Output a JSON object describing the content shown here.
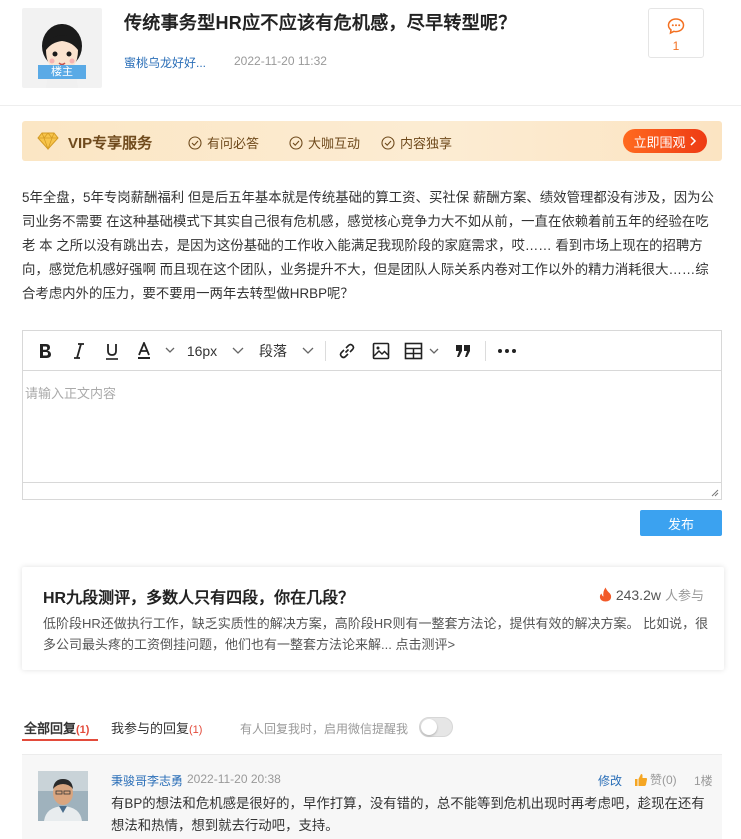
{
  "post": {
    "owner_tag": "楼主",
    "title": "传统事务型HR应不应该有危机感，尽早转型呢？",
    "author": "蜜桃乌龙好好...",
    "time": "2022-11-20 11:32",
    "comment_count": "1",
    "body": "5年全盘，5年专岗薪酬福利 但是后五年基本就是传统基础的算工资、买社保 薪酬方案、绩效管理都没有涉及，因为公司业务不需要 在这种基础模式下其实自己很有危机感，感觉核心竞争力大不如从前，一直在依赖着前五年的经验在吃老 本 之所以没有跳出去，是因为这份基础的工作收入能满足我现阶段的家庭需求，哎…… 看到市场上现在的招聘方向，感觉危机感好强啊 而且现在这个团队，业务提升不大，但是团队人际关系内卷对工作以外的精力消耗很大……综合考虑内外的压力，要不要用一两年去转型做HRBP呢？"
  },
  "vip": {
    "title": "VIP专享服务",
    "features": [
      "有问必答",
      "大咖互动",
      "内容独享"
    ],
    "button": "立即围观",
    "colors": {
      "accent": "#ee3b14",
      "text": "#6f4a1c",
      "background": "#fbe6c4"
    }
  },
  "editor": {
    "font_size": "16px",
    "paragraph": "段落",
    "placeholder": "请输入正文内容",
    "publish_label": "发布"
  },
  "promo": {
    "title": "HR九段测评，多数人只有四段，你在几段？",
    "count": "243.2w",
    "count_suffix": "人参与",
    "desc": "低阶段HR还做执行工作，缺乏实质性的解决方案，高阶段HR则有一整套方法论，提供有效的解决方案。 比如说，很多公司最头疼的工资倒挂问题，他们也有一整套方法论来解... 点击测评>"
  },
  "tabs": {
    "all": "全部回复",
    "all_count": "(1)",
    "mine": "我参与的回复",
    "mine_count": "(1)",
    "notify": "有人回复我时，启用微信提醒我"
  },
  "reply": {
    "name": "秉骏哥李志勇",
    "time": "2022-11-20 20:38",
    "edit": "修改",
    "like": "赞(0)",
    "floor": "1楼",
    "text": "有BP的想法和危机感是很好的，早作打算，没有错的，总不能等到危机出现时再考虑吧，趁现在还有想法和热情，想到就去行动吧，支持。"
  }
}
